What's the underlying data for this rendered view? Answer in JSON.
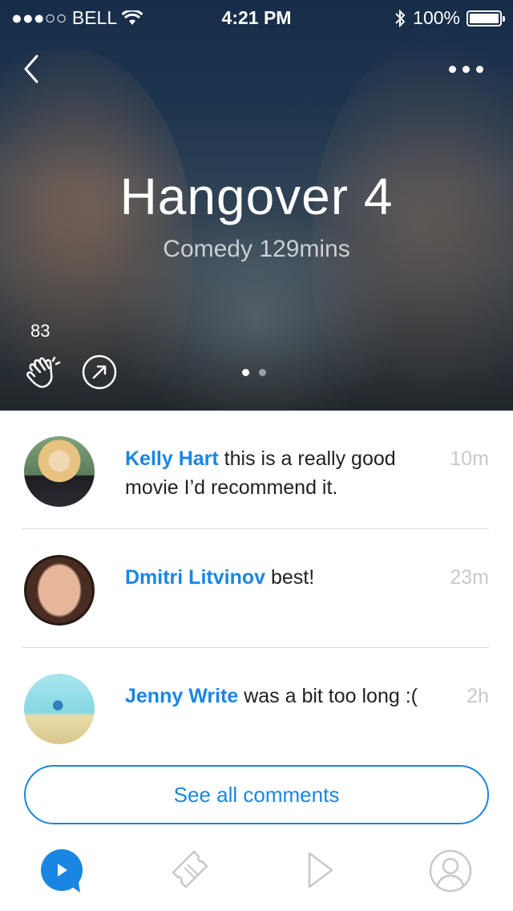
{
  "status_bar": {
    "carrier": "●●●○○ BELL",
    "time": "4:21 PM",
    "battery_percent": "100%"
  },
  "nav": {
    "back_icon": "chevron-left-icon",
    "more_icon": "ellipsis-icon"
  },
  "movie": {
    "title": "Hangover 4",
    "subtitle": "Comedy 129mins",
    "likes": "83",
    "pager_total": 2,
    "pager_active": 0
  },
  "comments": [
    {
      "author": "Kelly Hart",
      "text": " this is a really good movie I’d recommend it.",
      "time": "10m"
    },
    {
      "author": "Dmitri Litvinov",
      "text": " best!",
      "time": "23m"
    },
    {
      "author": "Jenny Write",
      "text": " was a bit too long :(",
      "time": "2h"
    }
  ],
  "see_all_label": "See all comments",
  "tabs": [
    {
      "icon": "play-circle-icon",
      "active": true
    },
    {
      "icon": "ticket-icon",
      "active": false
    },
    {
      "icon": "play-triangle-icon",
      "active": false
    },
    {
      "icon": "profile-icon",
      "active": false
    }
  ],
  "colors": {
    "accent": "#1a86e3",
    "time_gray": "#c9c9c9",
    "divider": "#d9d9d9"
  }
}
